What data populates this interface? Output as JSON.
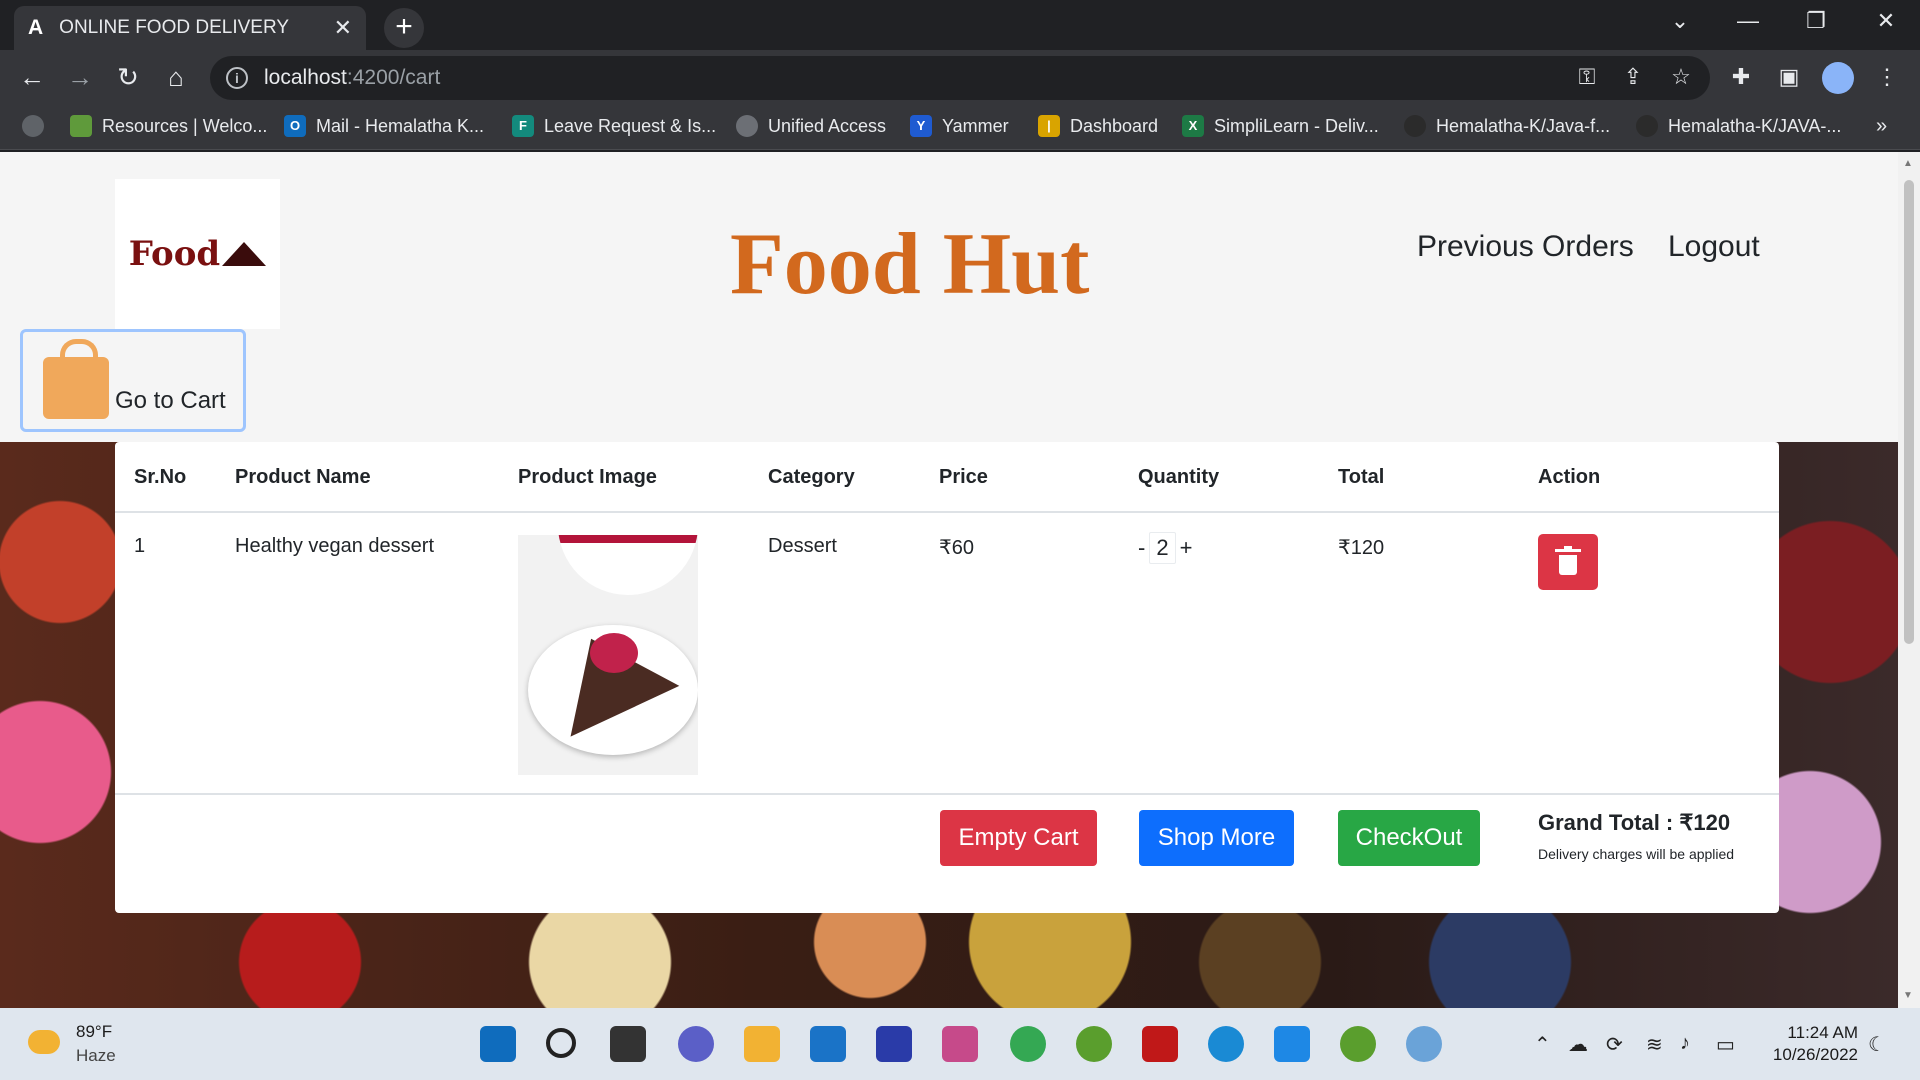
{
  "browser": {
    "tab_title": "ONLINE FOOD DELIVERY",
    "tab_icon_letter": "A",
    "url_host": "localhost",
    "url_path": ":4200/cart",
    "bookmarks": [
      {
        "label": "Resources | Welco...",
        "icon": "building-icon",
        "color": "#5f9a3b"
      },
      {
        "label": "Mail - Hemalatha K...",
        "icon": "outlook-icon",
        "color": "#0f6cbd"
      },
      {
        "label": "Leave Request & Is...",
        "icon": "forms-icon",
        "color": "#138a7d"
      },
      {
        "label": "Unified Access",
        "icon": "globe-icon",
        "color": "#6c6f75"
      },
      {
        "label": "Yammer",
        "icon": "yammer-icon",
        "color": "#1f5bd1"
      },
      {
        "label": "Dashboard",
        "icon": "chart-icon",
        "color": "#d9a400"
      },
      {
        "label": "SimpliLearn - Deliv...",
        "icon": "excel-icon",
        "color": "#1d7a45"
      },
      {
        "label": "Hemalatha-K/Java-f...",
        "icon": "github-icon",
        "color": "#2b2b2b"
      },
      {
        "label": "Hemalatha-K/JAVA-...",
        "icon": "github-icon",
        "color": "#2b2b2b"
      }
    ],
    "bookmarks_overflow": "»"
  },
  "header": {
    "logo_text": "Food",
    "brand": "Food Hut",
    "nav_previous_orders": "Previous Orders",
    "nav_logout": "Logout",
    "cart_button": "Go to Cart"
  },
  "table": {
    "columns": [
      "Sr.No",
      "Product Name",
      "Product Image",
      "Category",
      "Price",
      "Quantity",
      "Total",
      "Action"
    ],
    "rows": [
      {
        "sr": "1",
        "name": "Healthy vegan dessert",
        "category": "Dessert",
        "price": "₹60",
        "qty_minus": "-",
        "qty": "2",
        "qty_plus": "+",
        "total": "₹120"
      }
    ]
  },
  "actions": {
    "empty_cart": "Empty Cart",
    "shop_more": "Shop More",
    "checkout": "CheckOut",
    "grand_total": "Grand Total : ₹120",
    "delivery_note": "Delivery charges will be applied"
  },
  "taskbar": {
    "temperature": "89°F",
    "weather": "Haze",
    "time": "11:24 AM",
    "date": "10/26/2022"
  },
  "colors": {
    "brand": "#d2691e",
    "danger": "#dc3545",
    "primary": "#0d6efd",
    "success": "#28a745"
  }
}
